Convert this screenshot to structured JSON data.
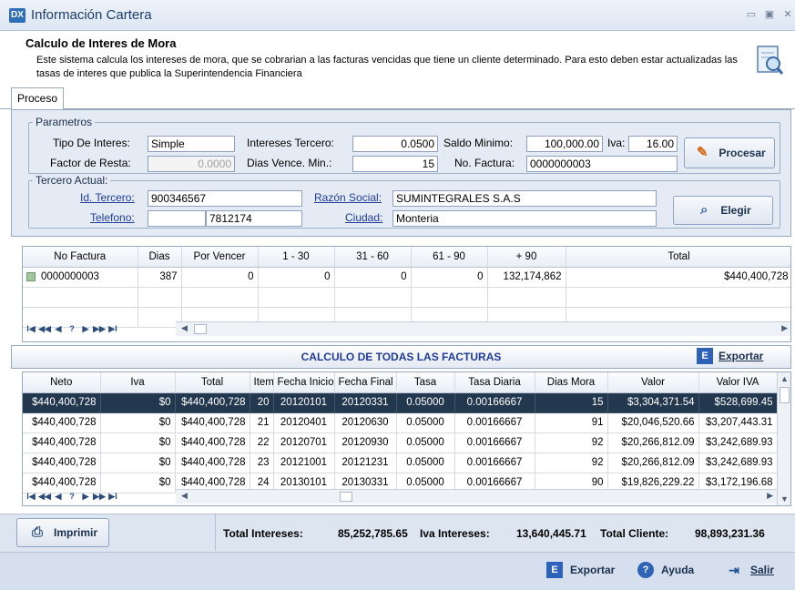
{
  "window": {
    "title": "Información Cartera",
    "app_icon": "DX"
  },
  "header": {
    "title": "Calculo de Interes de Mora",
    "description": "Este sistema calcula los intereses de mora, que se cobrarian a las facturas vencidas que tiene un cliente determinado. Para esto deben estar actualizadas las tasas de interes que publica la Superintendencia Financiera"
  },
  "tabs": [
    {
      "label": "Proceso"
    }
  ],
  "parametros": {
    "legend": "Parametros",
    "tipo_interes_label": "Tipo De Interes:",
    "tipo_interes": "Simple",
    "intereses_tercero_label": "Intereses Tercero:",
    "intereses_tercero": "0.0500",
    "saldo_minimo_label": "Saldo Minimo:",
    "saldo_minimo": "100,000.00",
    "iva_label": "Iva:",
    "iva": "16.00",
    "factor_resta_label": "Factor de Resta:",
    "factor_resta": "0.0000",
    "dias_vence_label": "Dias Vence. Min.:",
    "dias_vence": "15",
    "no_factura_label": "No. Factura:",
    "no_factura": "0000000003",
    "procesar_label": "Procesar"
  },
  "tercero": {
    "legend": "Tercero Actual:",
    "id_label": "Id. Tercero:",
    "id": "900346567",
    "razon_label": "Razón Social:",
    "razon": "SUMINTEGRALES S.A.S",
    "telefono_label": "Telefono:",
    "telefono1": "",
    "telefono2": "7812174",
    "ciudad_label": "Ciudad:",
    "ciudad": "Monteria",
    "elegir_label": "Elegir"
  },
  "facturas": {
    "columns": [
      "No Factura",
      "Dias",
      "Por Vencer",
      "1 - 30",
      "31 - 60",
      "61 - 90",
      "+ 90",
      "Total"
    ],
    "rows": [
      [
        "0000000003",
        "387",
        "0",
        "0",
        "0",
        "0",
        "132,174,862",
        "$440,400,728"
      ]
    ]
  },
  "calculo": {
    "title": "CALCULO DE TODAS LAS FACTURAS",
    "exportar_label": "Exportar",
    "columns": [
      "Neto",
      "Iva",
      "Total",
      "Item",
      "Fecha Inicio",
      "Fecha Final",
      "Tasa",
      "Tasa Diaria",
      "Dias Mora",
      "Valor",
      "Valor IVA"
    ],
    "rows": [
      [
        "$440,400,728",
        "$0",
        "$440,400,728",
        "20",
        "20120101",
        "20120331",
        "0.05000",
        "0.00166667",
        "15",
        "$3,304,371.54",
        "$528,699.45"
      ],
      [
        "$440,400,728",
        "$0",
        "$440,400,728",
        "21",
        "20120401",
        "20120630",
        "0.05000",
        "0.00166667",
        "91",
        "$20,046,520.66",
        "$3,207,443.31"
      ],
      [
        "$440,400,728",
        "$0",
        "$440,400,728",
        "22",
        "20120701",
        "20120930",
        "0.05000",
        "0.00166667",
        "92",
        "$20,266,812.09",
        "$3,242,689.93"
      ],
      [
        "$440,400,728",
        "$0",
        "$440,400,728",
        "23",
        "20121001",
        "20121231",
        "0.05000",
        "0.00166667",
        "92",
        "$20,266,812.09",
        "$3,242,689.93"
      ],
      [
        "$440,400,728",
        "$0",
        "$440,400,728",
        "24",
        "20130101",
        "20130331",
        "0.05000",
        "0.00166667",
        "90",
        "$19,826,229.22",
        "$3,172,196.68"
      ]
    ]
  },
  "totals": {
    "imprimir_label": "Imprimir",
    "total_intereses_label": "Total Intereses:",
    "total_intereses": "85,252,785.65",
    "iva_intereses_label": "Iva Intereses:",
    "iva_intereses": "13,640,445.71",
    "total_cliente_label": "Total Cliente:",
    "total_cliente": "98,893,231.36"
  },
  "footer": {
    "exportar_label": "Exportar",
    "ayuda_label": "Ayuda",
    "salir_label": "Salir"
  },
  "nav_glyphs": {
    "first": "I◀",
    "prev_page": "◀◀",
    "prev": "◀",
    "help": "?",
    "next": "▶",
    "next_page": "▶▶",
    "last": "▶I"
  }
}
